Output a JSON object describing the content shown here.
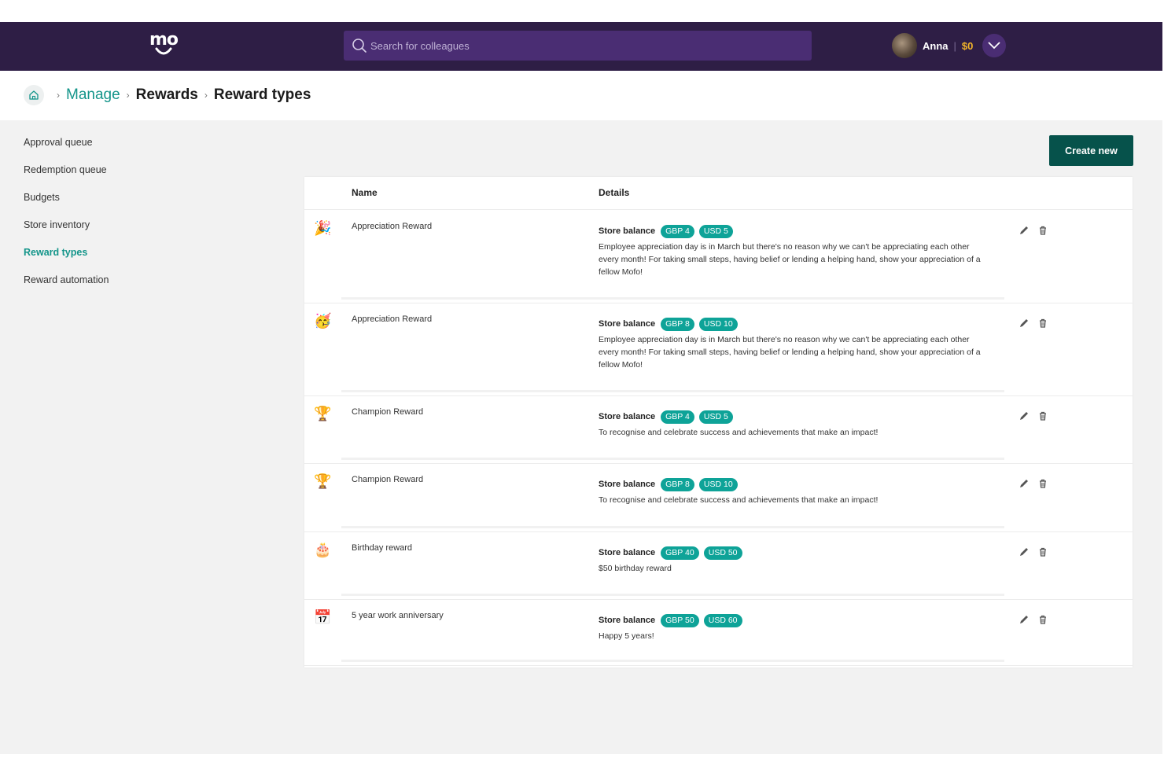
{
  "header": {
    "logo_text": "mo",
    "search_placeholder": "Search for colleagues",
    "user_name": "Anna",
    "separator": "|",
    "balance": "$0"
  },
  "breadcrumb": {
    "items": [
      "Manage",
      "Rewards",
      "Reward types"
    ]
  },
  "sidebar": {
    "items": [
      {
        "label": "Approval queue"
      },
      {
        "label": "Redemption queue"
      },
      {
        "label": "Budgets"
      },
      {
        "label": "Store inventory"
      },
      {
        "label": "Reward types",
        "active": true
      },
      {
        "label": "Reward automation"
      }
    ]
  },
  "create_button": "Create new",
  "table": {
    "headers": {
      "name": "Name",
      "details": "Details"
    },
    "store_balance_label": "Store balance",
    "rows": [
      {
        "icon": "party-popper-icon",
        "glyph": "🎉",
        "name": "Appreciation Reward",
        "gbp": "GBP 4",
        "usd": "USD 5",
        "description": "Employee appreciation day is in March but there's no reason why we can't be appreciating each other every month! For taking small steps, having belief or lending a helping hand, show your appreciation of a fellow Mofo!"
      },
      {
        "icon": "celebration-face-icon",
        "glyph": "🥳",
        "name": "Appreciation Reward",
        "gbp": "GBP 8",
        "usd": "USD 10",
        "description": "Employee appreciation day is in March but there's no reason why we can't be appreciating each other every month! For taking small steps, having belief or lending a helping hand, show your appreciation of a fellow Mofo!"
      },
      {
        "icon": "trophy-icon",
        "glyph": "🏆",
        "name": "Champion Reward",
        "gbp": "GBP 4",
        "usd": "USD 5",
        "description": "To recognise and celebrate success and achievements that make an impact!"
      },
      {
        "icon": "trophy-icon",
        "glyph": "🏆",
        "name": "Champion Reward",
        "gbp": "GBP 8",
        "usd": "USD 10",
        "description": "To recognise and celebrate success and achievements that make an impact!"
      },
      {
        "icon": "birthday-cake-icon",
        "glyph": "🎂",
        "name": "Birthday reward",
        "gbp": "GBP 40",
        "usd": "USD 50",
        "description": "$50 birthday reward"
      },
      {
        "icon": "calendar-icon",
        "glyph": "📅",
        "name": "5 year work anniversary",
        "gbp": "GBP 50",
        "usd": "USD 60",
        "description": "Happy 5 years!"
      }
    ]
  },
  "colors": {
    "topbar": "#2e1e45",
    "accent_teal": "#14958a",
    "pill": "#0ea398",
    "create_button": "#06524b",
    "balance": "#f2b52a"
  }
}
